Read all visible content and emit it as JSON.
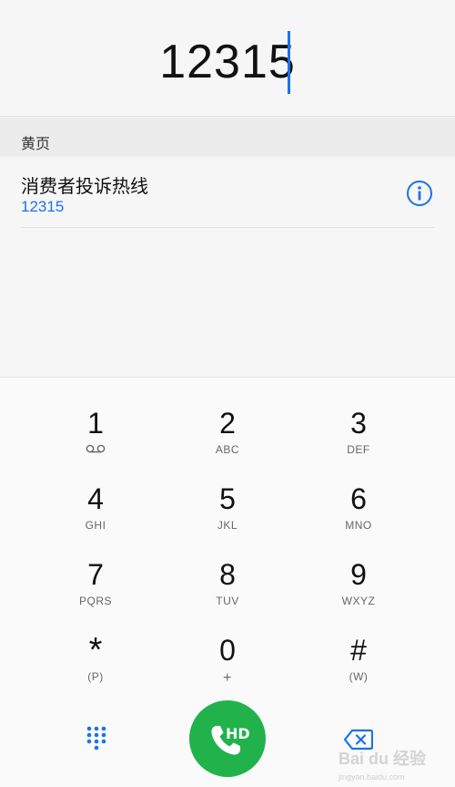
{
  "dialer": {
    "entered_number": "12315"
  },
  "results": {
    "section_title": "黄页",
    "items": [
      {
        "name": "消费者投诉热线",
        "number": "12315"
      }
    ]
  },
  "keypad": {
    "keys": [
      {
        "digit": "1",
        "letters": ""
      },
      {
        "digit": "2",
        "letters": "ABC"
      },
      {
        "digit": "3",
        "letters": "DEF"
      },
      {
        "digit": "4",
        "letters": "GHI"
      },
      {
        "digit": "5",
        "letters": "JKL"
      },
      {
        "digit": "6",
        "letters": "MNO"
      },
      {
        "digit": "7",
        "letters": "PQRS"
      },
      {
        "digit": "8",
        "letters": "TUV"
      },
      {
        "digit": "9",
        "letters": "WXYZ"
      },
      {
        "digit": "*",
        "letters": "(P)"
      },
      {
        "digit": "0",
        "letters": "+"
      },
      {
        "digit": "#",
        "letters": "(W)"
      }
    ]
  },
  "bottom_bar": {
    "call_badge": "HD",
    "watermark": "Bai du 经验",
    "watermark_sub": "jingyan.baidu.com"
  },
  "icons": {
    "voicemail": "voicemail-icon",
    "info": "info-icon",
    "dialpad": "dialpad-icon",
    "call": "phone-icon",
    "delete": "backspace-icon"
  },
  "colors": {
    "accent": "#1a73e8",
    "call_green": "#22b24c"
  }
}
